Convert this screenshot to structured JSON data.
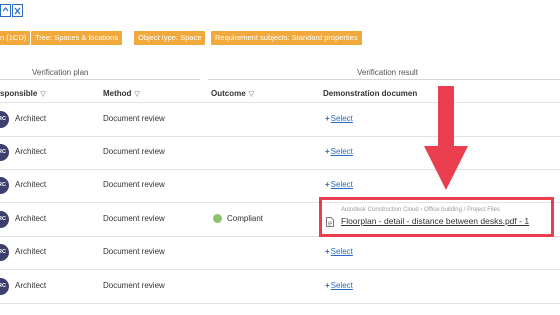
{
  "toolbar": {
    "icons": [
      "sync-icon",
      "excel-export-icon"
    ]
  },
  "chips": [
    "n (1CD)",
    "Tree: Spaces & locations",
    "Object type: Space",
    "Requirement subjects: Standard properties"
  ],
  "groups": {
    "verification_plan": "Verification plan",
    "verification_result": "Verification result"
  },
  "columns": {
    "responsible": "sponsible",
    "method": "Method",
    "outcome": "Outcome",
    "demonstration": "Demonstration documen"
  },
  "rows": [
    {
      "avatar": "RC",
      "responsible": "Architect",
      "method": "Document review",
      "outcome": "",
      "select": "Select"
    },
    {
      "avatar": "RC",
      "responsible": "Architect",
      "method": "Document review",
      "outcome": "",
      "select": "Select"
    },
    {
      "avatar": "RC",
      "responsible": "Architect",
      "method": "Document review",
      "outcome": "",
      "select": "Select"
    },
    {
      "avatar": "RC",
      "responsible": "Architect",
      "method": "Document review",
      "outcome": "Compliant",
      "select": ""
    },
    {
      "avatar": "RC",
      "responsible": "Architect",
      "method": "Document review",
      "outcome": "",
      "select": "Select"
    },
    {
      "avatar": "RC",
      "responsible": "Architect",
      "method": "Document review",
      "outcome": "",
      "select": "Select"
    }
  ],
  "document": {
    "path": "Autodesk Construction Cloud › Office building / Project Files",
    "name": "Floorplan - detail - distance between desks.pdf - 1"
  },
  "colors": {
    "chip": "#f2a93b",
    "link": "#2a6cc4",
    "compliant": "#8cc36a",
    "highlight": "#ea3e4e",
    "avatar": "#3d3f6e"
  }
}
